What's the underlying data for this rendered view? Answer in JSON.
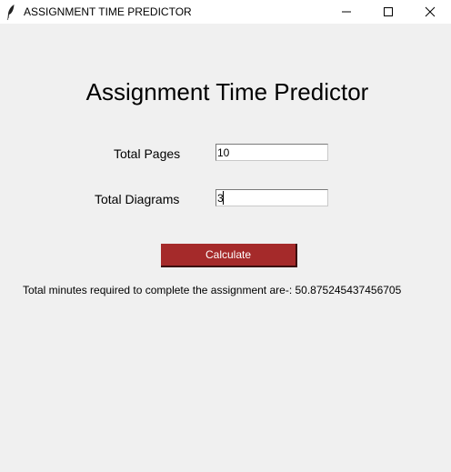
{
  "window": {
    "title": "ASSIGNMENT TIME PREDICTOR"
  },
  "icons": {
    "app": "feather-icon",
    "minimize": "minimize-icon",
    "maximize": "maximize-icon",
    "close": "close-icon"
  },
  "main": {
    "heading": "Assignment Time Predictor",
    "pages_label": "Total Pages",
    "pages_value": "10",
    "diagrams_label": "Total Diagrams",
    "diagrams_value": "3",
    "calculate_label": "Calculate",
    "result_text": "Total minutes required to complete the assignment are-: 50.875245437456705"
  },
  "colors": {
    "button_bg": "#a52a2a",
    "button_text": "#ffffff",
    "background": "#f0f0f0"
  }
}
